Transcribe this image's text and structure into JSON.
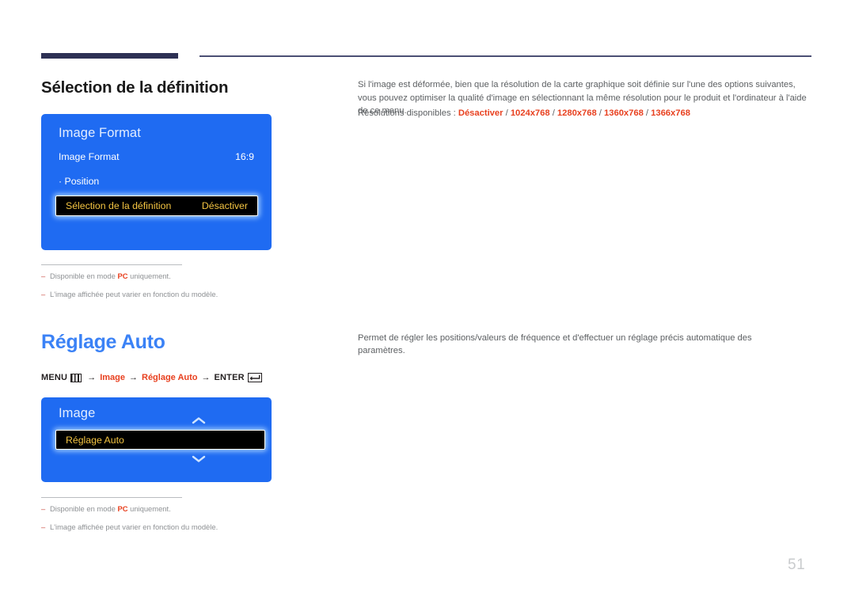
{
  "page": {
    "number": "51"
  },
  "section1": {
    "title": "Sélection de la définition",
    "description": "Si l'image est déformée, bien que la résolution de la carte graphique soit définie sur l'une des options suivantes, vous pouvez optimiser la qualité d'image en sélectionnant la même résolution pour le produit et l'ordinateur à l'aide de ce menu.",
    "resolutions_label": "Résolutions disponibles :",
    "resolutions": [
      "Désactiver",
      "1024x768",
      "1280x768",
      "1360x768",
      "1366x768"
    ],
    "osd": {
      "title": "Image Format",
      "rows": [
        {
          "label": "Image Format",
          "value": "16:9"
        },
        {
          "label": "· Position",
          "value": ""
        }
      ],
      "highlighted": {
        "label": "Sélection de la définition",
        "value": "Désactiver"
      }
    },
    "footnotes": [
      {
        "dash": "–",
        "pre": "Disponible en mode ",
        "bold": "PC",
        "post": " uniquement."
      },
      {
        "dash": "–",
        "pre": "L'image affichée peut varier en fonction du modèle.",
        "bold": "",
        "post": ""
      }
    ]
  },
  "section2": {
    "title": "Réglage Auto",
    "description": "Permet de régler les positions/valeurs de fréquence et d'effectuer un réglage précis automatique des paramètres.",
    "breadcrumb": {
      "menu_label": "MENU",
      "menu_icon": "menu-grid-icon",
      "arrow": "→",
      "path": [
        "Image",
        "Réglage Auto"
      ],
      "enter_label": "ENTER",
      "enter_icon": "enter-return-icon"
    },
    "osd": {
      "title": "Image",
      "up_icon": "chevron-up-icon",
      "down_icon": "chevron-down-icon",
      "highlighted": {
        "label": "Réglage Auto",
        "value": ""
      }
    },
    "footnotes": [
      {
        "dash": "–",
        "pre": "Disponible en mode ",
        "bold": "PC",
        "post": " uniquement."
      },
      {
        "dash": "–",
        "pre": "L'image affichée peut varier en fonction du modèle.",
        "bold": "",
        "post": ""
      }
    ]
  },
  "colors": {
    "osd_blue": "#1f6bf2",
    "accent_orange": "#e8401f",
    "heading_blue": "#3b82f6",
    "rule_navy": "#2e3155",
    "highlight_gold": "#f5c542"
  }
}
